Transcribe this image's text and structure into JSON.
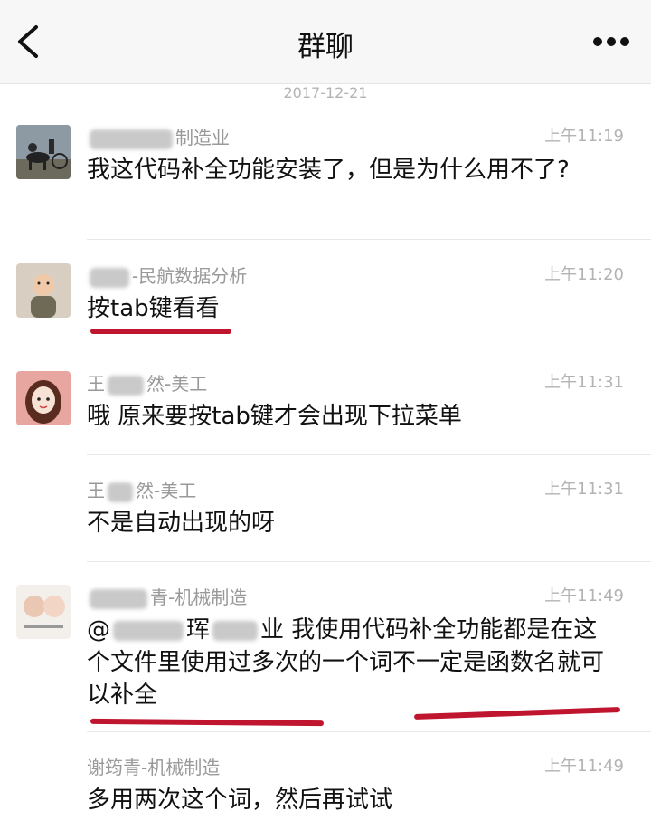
{
  "header": {
    "title": "群聊",
    "back_icon": "chevron-left-icon",
    "more_icon": "more-horizontal-icon"
  },
  "date_divider": "2017-12-21",
  "messages": [
    {
      "sender_suffix": "制造业",
      "time": "上午11:19",
      "text": "我这代码补全功能安装了，但是为什么用不了?",
      "avatar": "avatar-horse-rider"
    },
    {
      "sender_suffix": "-民航数据分析",
      "time": "上午11:20",
      "text": "按tab键看看",
      "avatar": "avatar-baby"
    },
    {
      "sender_prefix": "王",
      "sender_suffix": "然-美工",
      "time": "上午11:31",
      "text": "哦 原来要按tab键才会出现下拉菜单",
      "avatar": "avatar-cartoon-girl"
    },
    {
      "sender_prefix": "王",
      "sender_suffix": "然-美工",
      "time": "上午11:31",
      "text": "不是自动出现的呀"
    },
    {
      "sender_suffix": "青-机械制造",
      "time": "上午11:49",
      "mention_prefix": "@",
      "mention_fragment_1": "珲",
      "mention_fragment_2": "业",
      "text": "我使用代码补全功能都是在这个文件里使用过多次的一个词不一定是函数名就可以补全",
      "avatar": "avatar-couple-photo"
    },
    {
      "sender": "谢筠青-机械制造",
      "time": "上午11:49",
      "text": "多用两次这个词，然后再试试"
    }
  ],
  "colors": {
    "underline": "#c0152f",
    "header_bg": "#f7f7f7",
    "meta_text": "#999999"
  }
}
